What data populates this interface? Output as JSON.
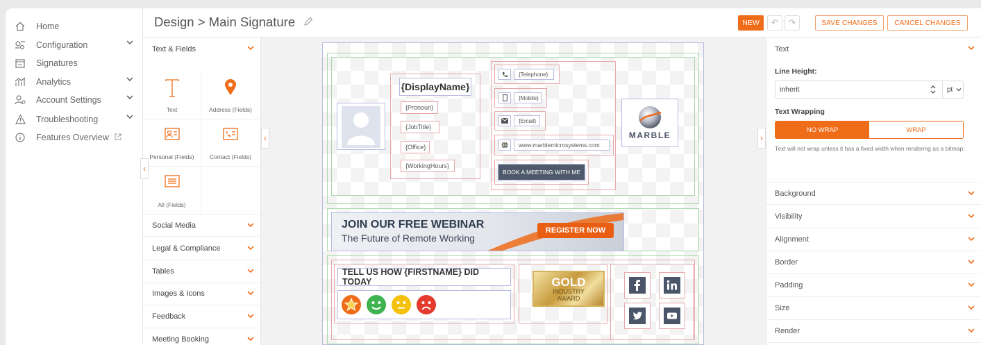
{
  "nav": {
    "items": [
      {
        "label": "Home",
        "icon": "home-icon",
        "chevron": false
      },
      {
        "label": "Configuration",
        "icon": "config-icon",
        "chevron": true
      },
      {
        "label": "Signatures",
        "icon": "signature-icon",
        "chevron": false
      },
      {
        "label": "Analytics",
        "icon": "analytics-icon",
        "chevron": true
      },
      {
        "label": "Account Settings",
        "icon": "account-icon",
        "chevron": true
      },
      {
        "label": "Troubleshooting",
        "icon": "warning-icon",
        "chevron": true
      },
      {
        "label": "Features Overview",
        "icon": "info-icon",
        "chevron": false
      }
    ]
  },
  "header": {
    "breadcrumb": "Design > Main Signature",
    "new_label": "NEW",
    "save_label": "SAVE CHANGES",
    "cancel_label": "CANCEL CHANGES"
  },
  "toolbox": {
    "section_text_fields": "Text & Fields",
    "tiles": {
      "text": "Text",
      "address": "Address (Fields)",
      "personal": "Personal (Fields)",
      "contact": "Contact (Fields)",
      "all": "All (Fields)"
    },
    "sections": [
      "Social Media",
      "Legal & Compliance",
      "Tables",
      "Images & Icons",
      "Feedback",
      "Meeting Booking"
    ]
  },
  "signature": {
    "display_name": "{DisplayName}",
    "pronoun": "{Pronoun}",
    "job_title": "{JobTitle}",
    "office": "{Office}",
    "working_hours": "{WorkingHours}",
    "telephone": "{Telephone}",
    "mobile": "{Mobile}",
    "email": "{Email}",
    "website": "www.marblemicrosystems.com",
    "book_meeting": "BOOK A MEETING WITH ME",
    "logo_text": "MARBLE",
    "banner_title": "JOIN OUR FREE WEBINAR",
    "banner_sub": "The Future of Remote Working",
    "banner_cta": "REGISTER NOW",
    "feedback_title": "TELL US HOW {FIRSTNAME} DID TODAY",
    "award_gold": "GOLD",
    "award_line1": "INDUSTRY",
    "award_line2": "AWARD"
  },
  "props": {
    "section_text": "Text",
    "line_height_label": "Line Height:",
    "line_height_value": "inherit",
    "line_height_unit": "pt",
    "wrapping_label": "Text Wrapping",
    "no_wrap": "NO WRAP",
    "wrap": "WRAP",
    "wrap_help": "Text will not wrap unless it has a fixed width when rendering as a bitmap.",
    "sections": [
      "Background",
      "Visibility",
      "Alignment",
      "Border",
      "Padding",
      "Size",
      "Render"
    ]
  },
  "colors": {
    "accent": "#ef6c19",
    "guide_green": "#a9d8a9",
    "guide_pink": "#e7a8aa",
    "guide_blue": "#b7bce2"
  }
}
